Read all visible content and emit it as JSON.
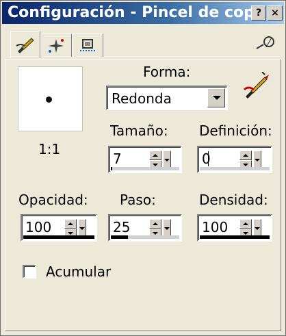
{
  "window": {
    "title": "Configuración - Pincel de cop",
    "buttons": {
      "help": "?",
      "close": "×"
    }
  },
  "tabs": [
    {
      "icon": "brush-tab-icon",
      "active": true
    },
    {
      "icon": "sparkle-tab-icon",
      "active": false
    },
    {
      "icon": "stamp-tab-icon",
      "active": false
    }
  ],
  "preview": {
    "scale_label": "1:1"
  },
  "forma": {
    "label": "Forma:",
    "value": "Redonda"
  },
  "tamano": {
    "label": "Tamaño:",
    "value": "7",
    "level": 0.02
  },
  "definicion": {
    "label": "Definición:",
    "value": "0",
    "level": 0.0
  },
  "opacidad": {
    "label": "Opacidad:",
    "value": "100",
    "level": 1.0
  },
  "paso": {
    "label": "Paso:",
    "value": "25",
    "level": 0.25
  },
  "densidad": {
    "label": "Densidad:",
    "value": "100",
    "level": 1.0
  },
  "acumular": {
    "label": "Acumular",
    "checked": false
  }
}
